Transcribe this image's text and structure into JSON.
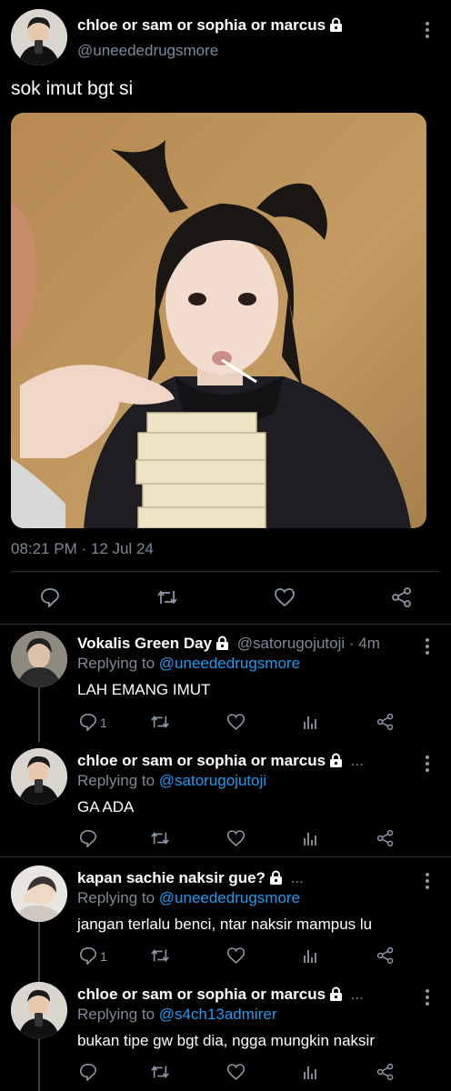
{
  "main_tweet": {
    "author_name": "chloe or sam or sophia or marcus",
    "author_handle": "@uneededrugsmore",
    "text": "sok imut bgt si",
    "timestamp": "08:21 PM · 12 Jul 24",
    "actions": [
      "reply-icon",
      "retweet-icon",
      "like-icon",
      "share-icon"
    ]
  },
  "replies": [
    {
      "author_name": "Vokalis Green Day",
      "author_handle": "@satorugojutoji",
      "time": "· 4m",
      "replying_prefix": "Replying to ",
      "replying_to": "@uneededrugsmore",
      "text": "LAH EMANG IMUT",
      "reply_count": "1"
    },
    {
      "author_name": "chloe or sam or sophia or marcus",
      "author_suffix": "...",
      "replying_prefix": "Replying to ",
      "replying_to": "@satorugojutoji",
      "text": "GA ADA"
    },
    {
      "author_name": "kapan sachie naksir gue?",
      "author_suffix": "...",
      "replying_prefix": "Replying to ",
      "replying_to": "@uneededrugsmore",
      "text": "jangan terlalu benci, ntar naksir mampus lu",
      "reply_count": "1"
    },
    {
      "author_name": "chloe or sam or sophia or marcus",
      "author_suffix": "...",
      "replying_prefix": "Replying to ",
      "replying_to": "@s4ch13admirer",
      "text": "bukan tipe gw bgt dia, ngga mungkin naksir"
    }
  ],
  "colors": {
    "accent": "#1d9bf0",
    "muted": "#7c8a97",
    "background": "#000000"
  }
}
